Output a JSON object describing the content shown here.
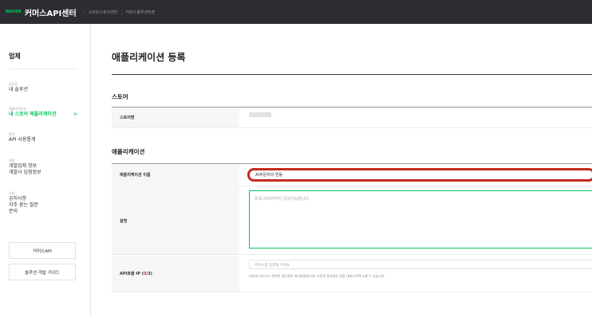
{
  "topbar": {
    "naver": "NAVER",
    "brand": "커머스API센터",
    "links": [
      "스마트스토어센터",
      "커머스솔루션마켓"
    ]
  },
  "sidebar": {
    "title": "업체",
    "groups": [
      {
        "category": "솔루션",
        "items": [
          "내 솔루션"
        ]
      },
      {
        "category": "애플리케이션",
        "items": [
          "내 스토어 애플리케이션"
        ],
        "active": true,
        "arrow": ">"
      },
      {
        "category": "통계",
        "items": [
          "API 사용통계"
        ]
      },
      {
        "category": "계정",
        "items": [
          "개발업체 정보",
          "개발사 입점정보"
        ]
      },
      {
        "category": "지원",
        "items": [
          "공지사항",
          "자주 묻는 질문",
          "문의"
        ]
      }
    ],
    "buttons": [
      "커머스API",
      "솔루션 개발 가이드"
    ]
  },
  "main": {
    "title": "애플리케이션 등록",
    "store_section": {
      "title": "스토어",
      "label": "스토어명"
    },
    "app_section": {
      "title": "애플리케이션",
      "name_label": "애플리케이션 이름",
      "name_value": "AI주문처리 연동",
      "desc_label": "설명",
      "desc_placeholder": "최대 200자까지 입력가능합니다.",
      "ip_label_prefix": "API호출 IP (",
      "ip_count": "0",
      "ip_label_suffix": "/3)",
      "ip_placeholder": "IP주소를 입력해 주세요.",
      "ip_help": "네이버 비즈니스 취약한 개인정보 처리방침에 따라 기준에 동의받은 범위 내에서 IP주소를 수 있습니다."
    }
  },
  "colors": {
    "accent": "#03c75a",
    "highlight": "#c62a20",
    "topbar": "#2b2d31"
  }
}
